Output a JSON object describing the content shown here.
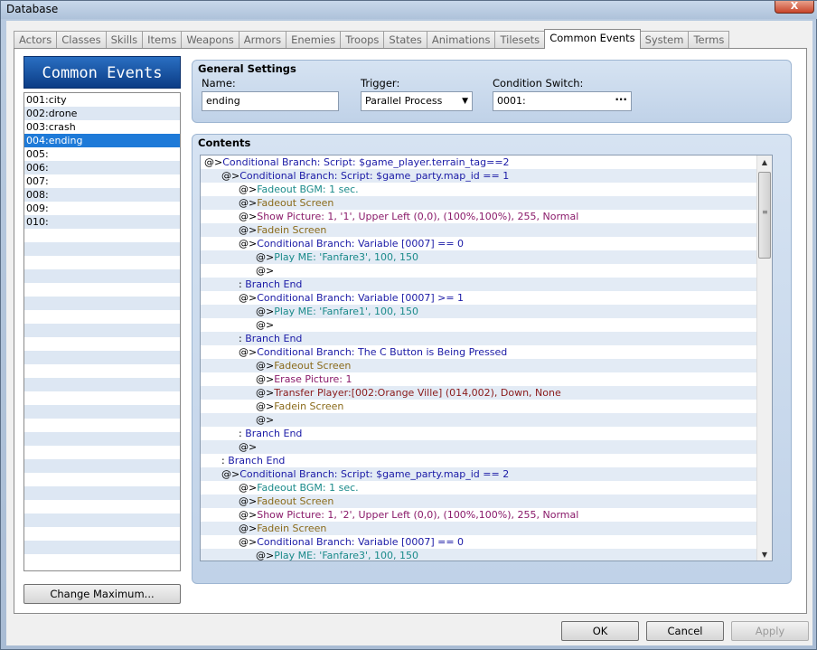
{
  "window": {
    "title": "Database",
    "close_label": "X"
  },
  "tabs": [
    {
      "label": "Actors"
    },
    {
      "label": "Classes"
    },
    {
      "label": "Skills"
    },
    {
      "label": "Items"
    },
    {
      "label": "Weapons"
    },
    {
      "label": "Armors"
    },
    {
      "label": "Enemies"
    },
    {
      "label": "Troops"
    },
    {
      "label": "States"
    },
    {
      "label": "Animations"
    },
    {
      "label": "Tilesets"
    },
    {
      "label": "Common Events",
      "active": true
    },
    {
      "label": "System"
    },
    {
      "label": "Terms"
    }
  ],
  "list": {
    "header": "Common Events",
    "items": [
      "001:city",
      "002:drone",
      "003:crash",
      "004:ending",
      "005:",
      "006:",
      "007:",
      "008:",
      "009:",
      "010:"
    ],
    "selected_index": 3,
    "change_max_label": "Change Maximum..."
  },
  "general": {
    "title": "General Settings",
    "name_label": "Name:",
    "name_value": "ending",
    "trigger_label": "Trigger:",
    "trigger_value": "Parallel Process",
    "switch_label": "Condition Switch:",
    "switch_value": "0001:"
  },
  "contents": {
    "title": "Contents",
    "lines": [
      {
        "indent": 0,
        "mk": "@>",
        "text": "Conditional Branch: Script: $game_player.terrain_tag==2",
        "color": "#1a1aa6"
      },
      {
        "indent": 1,
        "mk": "@>",
        "text": "Conditional Branch: Script: $game_party.map_id == 1",
        "color": "#1a1aa6"
      },
      {
        "indent": 2,
        "mk": "@>",
        "text": "Fadeout BGM: 1 sec.",
        "color": "#1a8a8a"
      },
      {
        "indent": 2,
        "mk": "@>",
        "text": "Fadeout Screen",
        "color": "#8a6a1a"
      },
      {
        "indent": 2,
        "mk": "@>",
        "text": "Show Picture: 1, '1', Upper Left (0,0), (100%,100%), 255, Normal",
        "color": "#8a1a6a"
      },
      {
        "indent": 2,
        "mk": "@>",
        "text": "Fadein Screen",
        "color": "#8a6a1a"
      },
      {
        "indent": 2,
        "mk": "@>",
        "text": "Conditional Branch: Variable [0007] == 0",
        "color": "#1a1aa6"
      },
      {
        "indent": 3,
        "mk": "@>",
        "text": "Play ME: 'Fanfare3', 100, 150",
        "color": "#1a8a8a"
      },
      {
        "indent": 3,
        "mk": "@>",
        "text": "",
        "color": "#000000"
      },
      {
        "indent": 2,
        "mk": " : ",
        "text": "Branch End",
        "color": "#1a1aa6"
      },
      {
        "indent": 2,
        "mk": "@>",
        "text": "Conditional Branch: Variable [0007] >= 1",
        "color": "#1a1aa6"
      },
      {
        "indent": 3,
        "mk": "@>",
        "text": "Play ME: 'Fanfare1', 100, 150",
        "color": "#1a8a8a"
      },
      {
        "indent": 3,
        "mk": "@>",
        "text": "",
        "color": "#000000"
      },
      {
        "indent": 2,
        "mk": " : ",
        "text": "Branch End",
        "color": "#1a1aa6"
      },
      {
        "indent": 2,
        "mk": "@>",
        "text": "Conditional Branch: The C Button is Being Pressed",
        "color": "#1a1aa6"
      },
      {
        "indent": 3,
        "mk": "@>",
        "text": "Fadeout Screen",
        "color": "#8a6a1a"
      },
      {
        "indent": 3,
        "mk": "@>",
        "text": "Erase Picture: 1",
        "color": "#8a1a6a"
      },
      {
        "indent": 3,
        "mk": "@>",
        "text": "Transfer Player:[002:Orange Ville] (014,002), Down, None",
        "color": "#8a1a1a"
      },
      {
        "indent": 3,
        "mk": "@>",
        "text": "Fadein Screen",
        "color": "#8a6a1a"
      },
      {
        "indent": 3,
        "mk": "@>",
        "text": "",
        "color": "#000000"
      },
      {
        "indent": 2,
        "mk": " : ",
        "text": "Branch End",
        "color": "#1a1aa6"
      },
      {
        "indent": 2,
        "mk": "@>",
        "text": "",
        "color": "#000000"
      },
      {
        "indent": 1,
        "mk": " : ",
        "text": "Branch End",
        "color": "#1a1aa6"
      },
      {
        "indent": 1,
        "mk": "@>",
        "text": "Conditional Branch: Script: $game_party.map_id == 2",
        "color": "#1a1aa6"
      },
      {
        "indent": 2,
        "mk": "@>",
        "text": "Fadeout BGM: 1 sec.",
        "color": "#1a8a8a"
      },
      {
        "indent": 2,
        "mk": "@>",
        "text": "Fadeout Screen",
        "color": "#8a6a1a"
      },
      {
        "indent": 2,
        "mk": "@>",
        "text": "Show Picture: 1, '2', Upper Left (0,0), (100%,100%), 255, Normal",
        "color": "#8a1a6a"
      },
      {
        "indent": 2,
        "mk": "@>",
        "text": "Fadein Screen",
        "color": "#8a6a1a"
      },
      {
        "indent": 2,
        "mk": "@>",
        "text": "Conditional Branch: Variable [0007] == 0",
        "color": "#1a1aa6"
      },
      {
        "indent": 3,
        "mk": "@>",
        "text": "Play ME: 'Fanfare3', 100, 150",
        "color": "#1a8a8a"
      }
    ]
  },
  "footer": {
    "ok_label": "OK",
    "cancel_label": "Cancel",
    "apply_label": "Apply"
  }
}
